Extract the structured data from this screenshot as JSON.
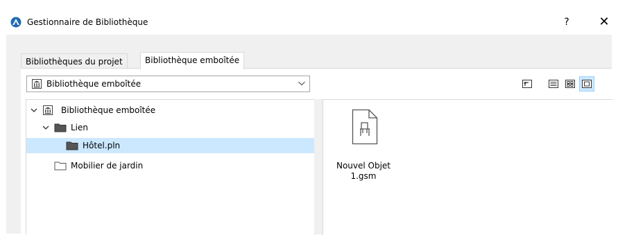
{
  "window": {
    "title": "Gestionnaire de Bibliothèque",
    "help_label": "?",
    "close_label": "✕"
  },
  "tabs": [
    {
      "label": "Bibliothèques du projet",
      "active": false
    },
    {
      "label": "Bibliothèque emboîtée",
      "active": true
    }
  ],
  "library_select": {
    "selected": "Bibliothèque emboîtée",
    "icon": "library-building-icon"
  },
  "toolbar": {
    "buttons": [
      {
        "name": "go-up-folder",
        "icon": "folder-up-icon",
        "selected": false
      },
      {
        "name": "list-view",
        "icon": "list-view-icon",
        "selected": false
      },
      {
        "name": "small-icons-view",
        "icon": "grid-view-icon",
        "selected": false
      },
      {
        "name": "large-icons-view",
        "icon": "large-icon-view-icon",
        "selected": true
      }
    ]
  },
  "tree": {
    "items": [
      {
        "label": "Bibliothèque emboîtée",
        "icon": "library-building-icon",
        "expanded": true,
        "level": 0
      },
      {
        "label": "Lien",
        "icon": "folder-dark-icon",
        "expanded": true,
        "level": 1
      },
      {
        "label": "Hôtel.pln",
        "icon": "folder-dark-icon",
        "selected": true,
        "level": 2
      },
      {
        "label": "Mobilier de jardin",
        "icon": "folder-icon",
        "level": 1
      }
    ]
  },
  "preview": {
    "items": [
      {
        "label": "Nouvel Objet 1.gsm",
        "line1": "Nouvel Objet",
        "line2": "1.gsm",
        "icon": "gsm-object-chair-icon"
      }
    ]
  },
  "colors": {
    "selection": "#cce8ff",
    "selection_border": "#99d1ff",
    "dialog_bg": "#f0f0f0",
    "app_icon": "#1f6bb5"
  }
}
